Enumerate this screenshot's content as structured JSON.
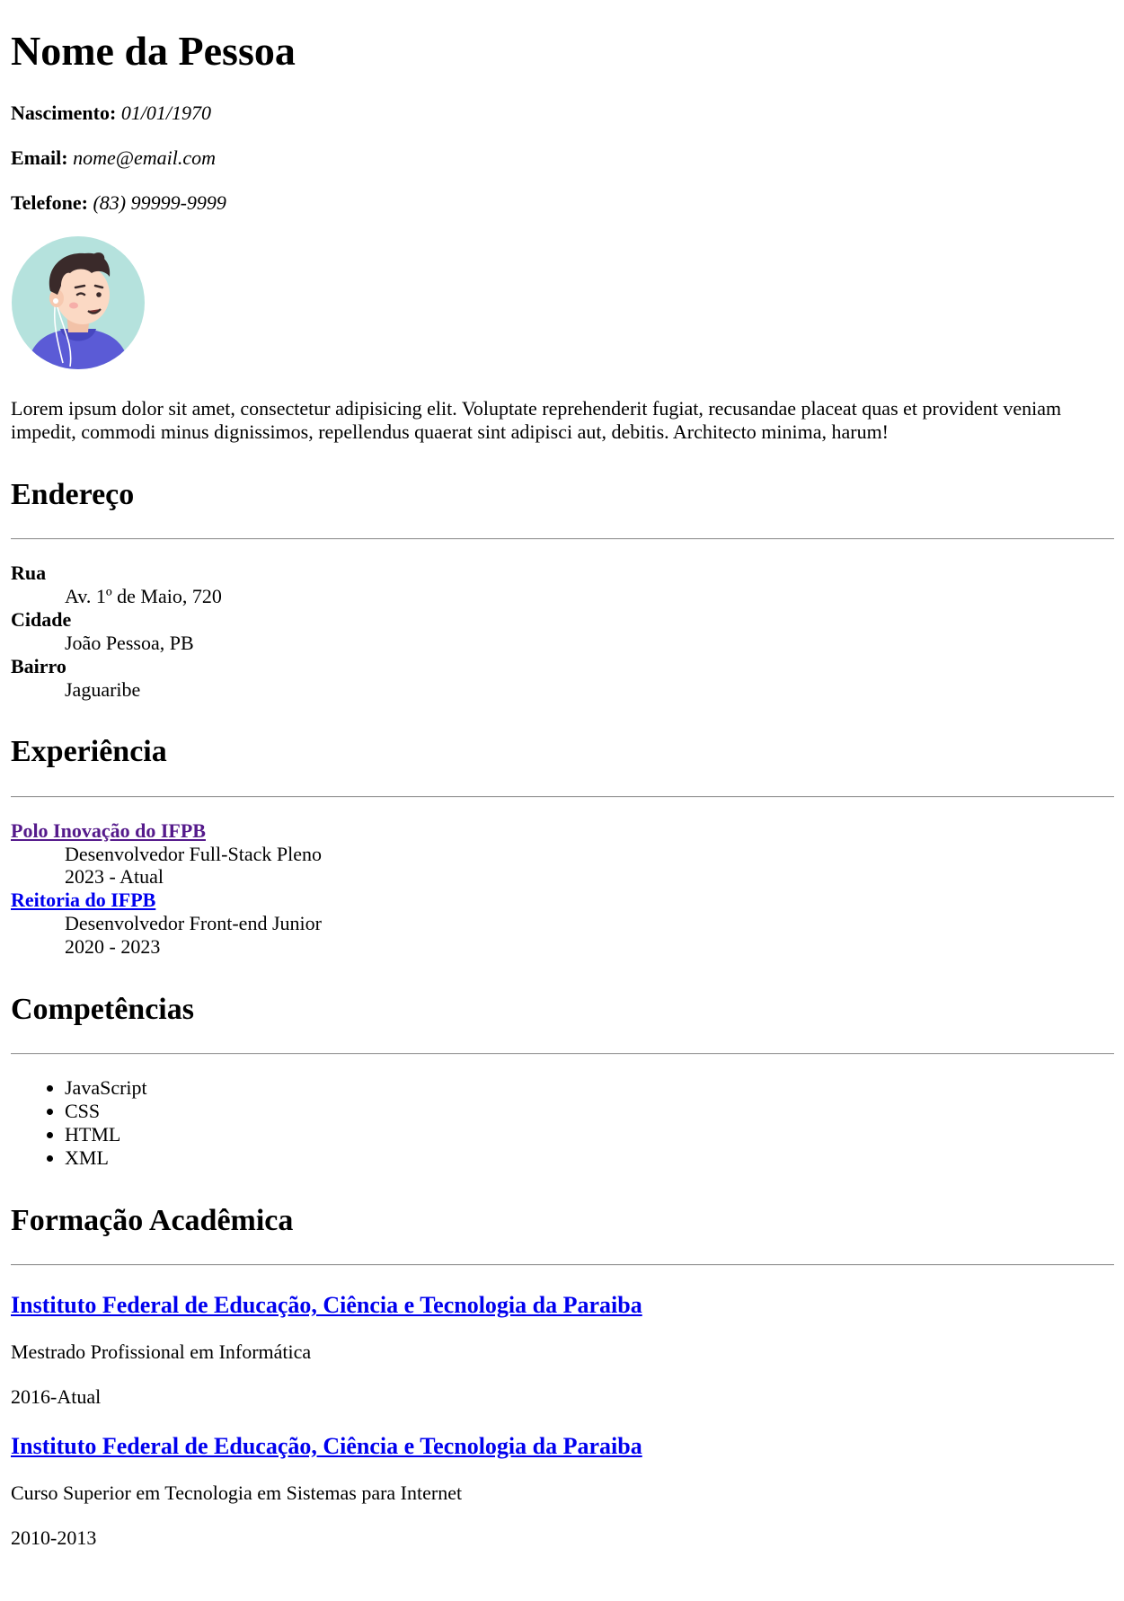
{
  "header": {
    "name": "Nome da Pessoa",
    "birth_label": "Nascimento:",
    "birth_value": "01/01/1970",
    "email_label": "Email:",
    "email_value": "nome@email.com",
    "phone_label": "Telefone:",
    "phone_value": "(83) 99999-9999",
    "avatar_icon": "person-avatar-icon",
    "bio": "Lorem ipsum dolor sit amet, consectetur adipisicing elit. Voluptate reprehenderit fugiat, recusandae placeat quas et provident veniam impedit, commodi minus dignissimos, repellendus quaerat sint adipisci aut, debitis. Architecto minima, harum!"
  },
  "address": {
    "title": "Endereço",
    "items": [
      {
        "term": "Rua",
        "value": "Av. 1º de Maio, 720"
      },
      {
        "term": "Cidade",
        "value": "João Pessoa, PB"
      },
      {
        "term": "Bairro",
        "value": "Jaguaribe"
      }
    ]
  },
  "experience": {
    "title": "Experiência",
    "items": [
      {
        "company": "Polo Inovação do IFPB",
        "role": "Desenvolvedor Full-Stack Pleno",
        "period": "2023 - Atual",
        "visited": true
      },
      {
        "company": "Reitoria do IFPB",
        "role": "Desenvolvedor Front-end Junior",
        "period": "2020 - 2023",
        "visited": false
      }
    ]
  },
  "skills": {
    "title": "Competências",
    "items": [
      "JavaScript",
      "CSS",
      "HTML",
      "XML"
    ]
  },
  "education": {
    "title": "Formação Acadêmica",
    "items": [
      {
        "institution": "Instituto Federal de Educação, Ciência e Tecnologia da Paraiba",
        "course": "Mestrado Profissional em Informática",
        "period": "2016-Atual"
      },
      {
        "institution": "Instituto Federal de Educação, Ciência e Tecnologia da Paraiba",
        "course": "Curso Superior em Tecnologia em Sistemas para Internet",
        "period": "2010-2013"
      }
    ]
  },
  "colors": {
    "link": "#0000ee",
    "visited_link": "#551a8b",
    "divider": "#999999",
    "avatar_bg": "#b5e2dd",
    "avatar_shirt": "#5b5bd6",
    "avatar_hair": "#3a2a2a",
    "avatar_skin": "#fbd9c4"
  }
}
